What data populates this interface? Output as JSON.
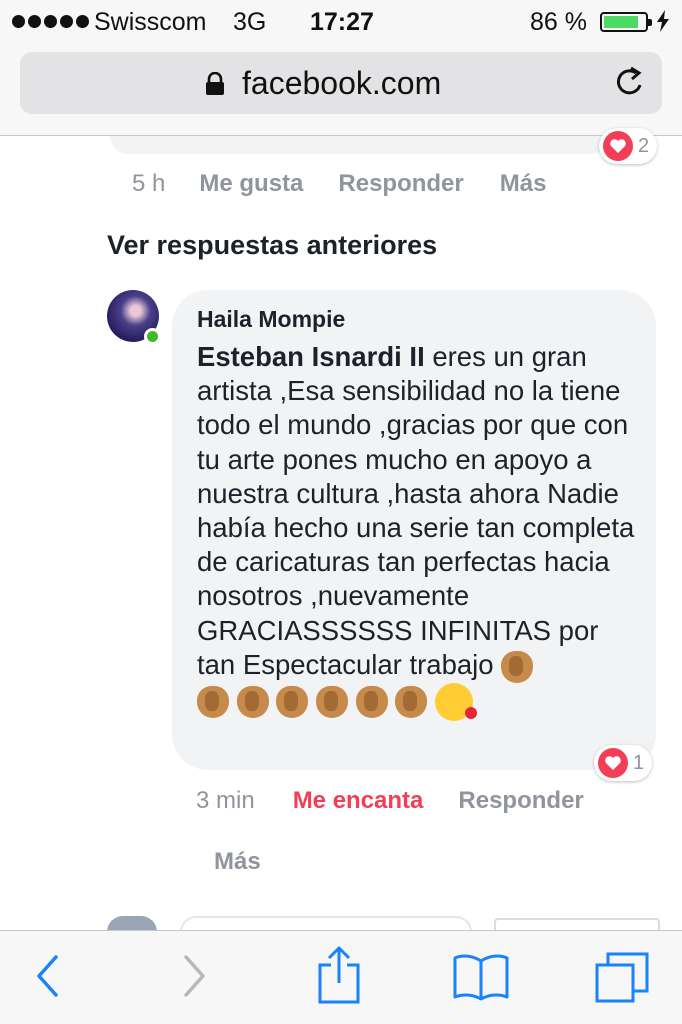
{
  "status_bar": {
    "carrier": "Swisscom",
    "network": "3G",
    "time": "17:27",
    "battery": "86 %",
    "battery_level": 0.86,
    "signal_dots": 5,
    "battery_color": "#4cd964"
  },
  "browser": {
    "url": "facebook.com",
    "lock_icon": "lock-icon",
    "reload_icon": "reload-icon"
  },
  "previous_comment": {
    "reaction_count": "2",
    "time": "5 h",
    "like": "Me gusta",
    "reply": "Responder",
    "more": "Más"
  },
  "view_previous_replies": "Ver respuestas anteriores",
  "comment": {
    "author": "Haila Mompie",
    "mention": "Esteban Isnardi II",
    "body": " eres un gran artista ,Esa sensibilidad no la tiene todo el mundo ,gracias por que con tu arte pones mucho en apoyo a nuestra cultura ,hasta ahora Nadie había hecho una serie tan completa de caricaturas tan perfectas hacia nosotros ,nuevamente GRACIASSSSSS INFINITAS por tan Espectacular trabajo ",
    "emojis": [
      "clapping-hands",
      "clapping-hands",
      "clapping-hands",
      "clapping-hands",
      "clapping-hands",
      "clapping-hands",
      "clapping-hands",
      "face-blowing-kiss"
    ],
    "reaction_count": "1",
    "time": "3 min",
    "love": "Me encanta",
    "reply": "Responder",
    "more": "Más",
    "love_color": "#f33e58"
  },
  "toolbar": {
    "back_icon": "back-icon",
    "forward_icon": "forward-icon",
    "share_icon": "share-icon",
    "bookmarks_icon": "bookmarks-icon",
    "tabs_icon": "tabs-icon",
    "accent": "#1a82fb"
  }
}
